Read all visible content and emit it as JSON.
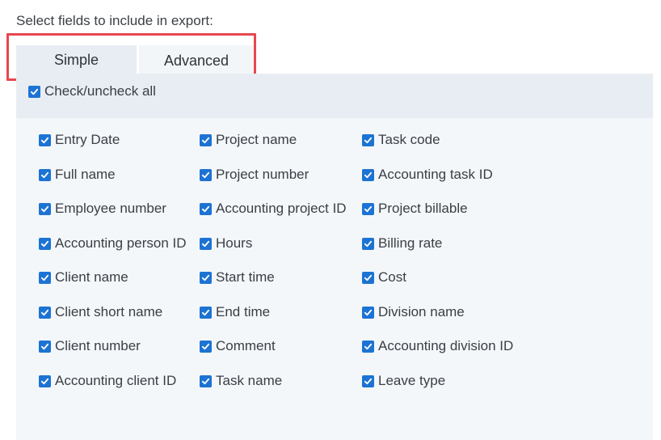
{
  "heading": "Select fields to include in export:",
  "tabs": [
    {
      "label": "Simple",
      "active": true
    },
    {
      "label": "Advanced",
      "active": false
    }
  ],
  "check_all": {
    "label": "Check/uncheck all",
    "checked": true
  },
  "columns": [
    {
      "fields": [
        {
          "label": "Entry Date",
          "checked": true
        },
        {
          "label": "Full name",
          "checked": true
        },
        {
          "label": "Employee number",
          "checked": true
        },
        {
          "label": "Accounting person ID",
          "checked": true
        },
        {
          "label": "Client name",
          "checked": true
        },
        {
          "label": "Client short name",
          "checked": true
        },
        {
          "label": "Client number",
          "checked": true
        },
        {
          "label": "Accounting client ID",
          "checked": true
        }
      ]
    },
    {
      "fields": [
        {
          "label": "Project name",
          "checked": true
        },
        {
          "label": "Project number",
          "checked": true
        },
        {
          "label": "Accounting project ID",
          "checked": true
        },
        {
          "label": "Hours",
          "checked": true
        },
        {
          "label": "Start time",
          "checked": true
        },
        {
          "label": "End time",
          "checked": true
        },
        {
          "label": "Comment",
          "checked": true
        },
        {
          "label": "Task name",
          "checked": true
        }
      ]
    },
    {
      "fields": [
        {
          "label": "Task code",
          "checked": true
        },
        {
          "label": "Accounting task ID",
          "checked": true
        },
        {
          "label": "Project billable",
          "checked": true
        },
        {
          "label": "Billing rate",
          "checked": true
        },
        {
          "label": "Cost",
          "checked": true
        },
        {
          "label": "Division name",
          "checked": true
        },
        {
          "label": "Accounting division ID",
          "checked": true
        },
        {
          "label": "Leave type",
          "checked": true
        }
      ]
    }
  ],
  "colors": {
    "checkbox": "#1d73d3",
    "highlight": "#e8474f",
    "tab_active": "#e7edf2",
    "panel": "#f3f7fa"
  }
}
